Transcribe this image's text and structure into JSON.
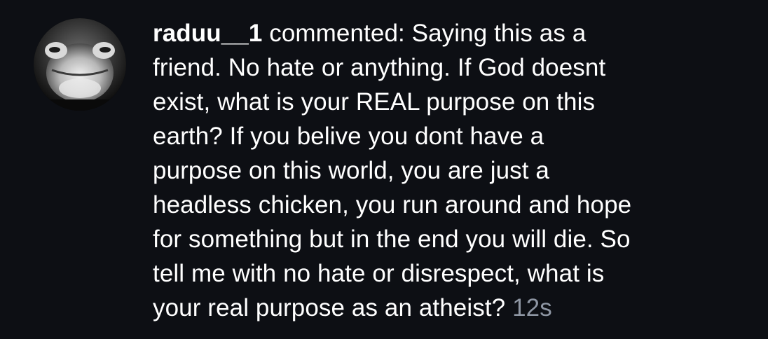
{
  "comment": {
    "username": "raduu__1",
    "action": " commented: ",
    "lines": [
      "Saying this as a",
      "friend. No hate or anything. If God doesnt",
      "exist, what is your REAL purpose on this",
      "earth? If you belive you dont have a",
      "purpose on this world, you are just a",
      "headless chicken, you run around and hope",
      "for something but in the end you will die. So",
      "tell me with no hate or disrespect, what is",
      "your real purpose as an atheist?"
    ],
    "timestamp": "12s"
  },
  "avatar": {
    "icon": "frog-avatar-icon"
  },
  "colors": {
    "background": "#0d0f14",
    "text": "#ffffff",
    "timestamp": "#8e96a3"
  }
}
